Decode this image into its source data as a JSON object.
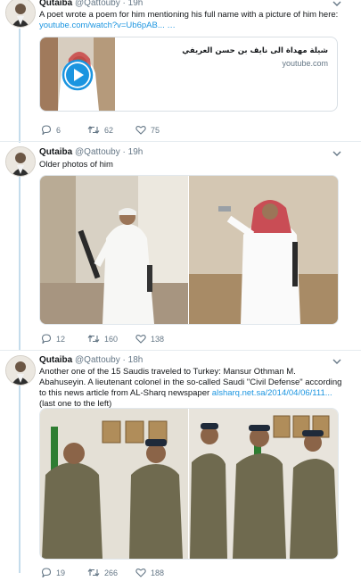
{
  "tweets": [
    {
      "name": "Qutaiba",
      "handle": "@Qattouby",
      "time": "19h",
      "text": "A poet wrote a poem for him mentioning his full name with a picture of him here:",
      "link": "youtube.com/watch?v=Ub6pAB...",
      "link_suffix": " …",
      "card": {
        "title": "شيلة مهداة الى نايف بن حسن العريفي",
        "domain": "youtube.com"
      },
      "replies": "6",
      "retweets": "62",
      "likes": "75"
    },
    {
      "name": "Qutaiba",
      "handle": "@Qattouby",
      "time": "19h",
      "text": "Older photos of him",
      "replies": "12",
      "retweets": "160",
      "likes": "138"
    },
    {
      "name": "Qutaiba",
      "handle": "@Qattouby",
      "time": "18h",
      "text_prefix": "Another one of the 15 Saudis traveled to Turkey: Mansur Othman M. Abahuseyin. A lieutenant colonel in the so-called Saudi \"Civil Defense\" according to this news article from AL-Sharq newspaper ",
      "link": "alsharq.net.sa/2014/04/06/111...",
      "text_suffix": " (last one to the left)",
      "replies": "19",
      "retweets": "266",
      "likes": "188"
    }
  ],
  "colors": {
    "accent": "#1b95e0",
    "meta": "#657786",
    "thread": "#c4dcec",
    "divider": "#e6ecf0"
  },
  "icons": [
    "reply-icon",
    "retweet-icon",
    "like-icon",
    "chevron-down-icon",
    "play-icon"
  ]
}
